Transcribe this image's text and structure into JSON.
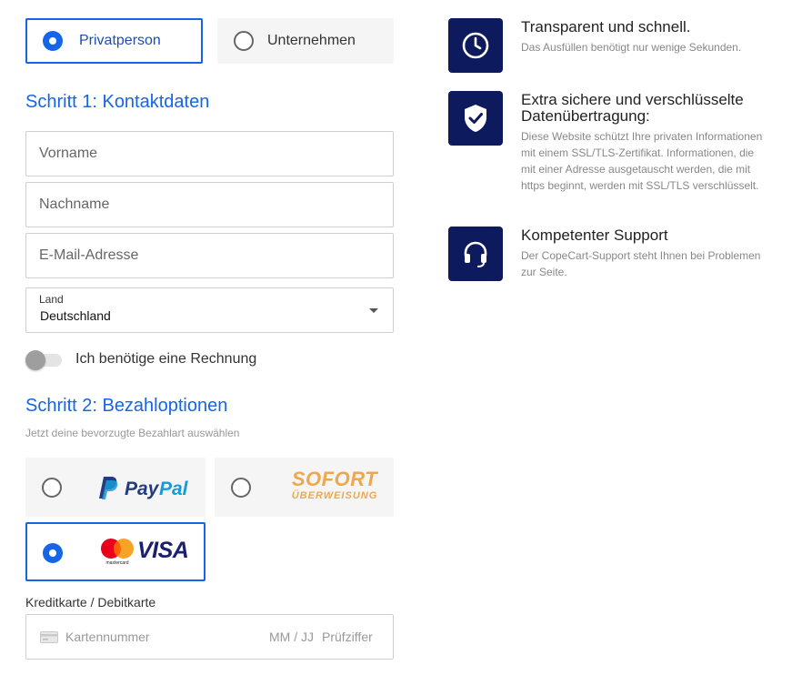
{
  "customer_type": {
    "options": [
      {
        "label": "Privatperson",
        "selected": true
      },
      {
        "label": "Unternehmen",
        "selected": false
      }
    ]
  },
  "step1": {
    "title": "Schritt 1: Kontaktdaten",
    "first_name_placeholder": "Vorname",
    "last_name_placeholder": "Nachname",
    "email_placeholder": "E-Mail-Adresse",
    "country_label": "Land",
    "country_value": "Deutschland",
    "invoice_toggle_label": "Ich benötige eine Rechnung",
    "invoice_toggle_on": false
  },
  "step2": {
    "title": "Schritt 2: Bezahloptionen",
    "subtitle": "Jetzt deine bevorzugte Bezahlart auswählen",
    "methods": [
      {
        "name": "PayPal",
        "selected": false
      },
      {
        "name": "SOFORT ÜBERWEISUNG",
        "logo_top": "SOFORT",
        "logo_bottom": "ÜBERWEISUNG",
        "selected": false
      },
      {
        "name": "Mastercard / VISA",
        "logo_small": "mastercard",
        "logo_visa": "VISA",
        "selected": true
      }
    ],
    "card_section_label": "Kreditkarte / Debitkarte",
    "card_number_placeholder": "Kartennummer",
    "expiry_placeholder": "MM / JJ",
    "cvc_placeholder": "Prüfziffer"
  },
  "features": [
    {
      "icon": "clock-icon",
      "title": "Transparent und schnell.",
      "description": "Das Ausfüllen benötigt nur wenige Sekunden."
    },
    {
      "icon": "shield-check-icon",
      "title": "Extra sichere und verschlüsselte Datenübertragung:",
      "description": "Diese Website schützt Ihre privaten Informationen mit einem SSL/TLS-Zertifikat. Informationen, die mit einer Adresse ausgetauscht werden, die mit https beginnt, werden mit SSL/TLS verschlüsselt."
    },
    {
      "icon": "headset-icon",
      "title": "Kompetenter Support",
      "description": "Der CopeCart-Support steht Ihnen bei Problemen zur Seite."
    }
  ],
  "colors": {
    "accent": "#1565e8",
    "icon_bg": "#0d1a5e",
    "paypal_dark": "#253b80",
    "paypal_light": "#179bd7",
    "sofort": "#eea74e",
    "visa": "#1a1f71",
    "mc_red": "#eb001b",
    "mc_yellow": "#f79e1b"
  }
}
